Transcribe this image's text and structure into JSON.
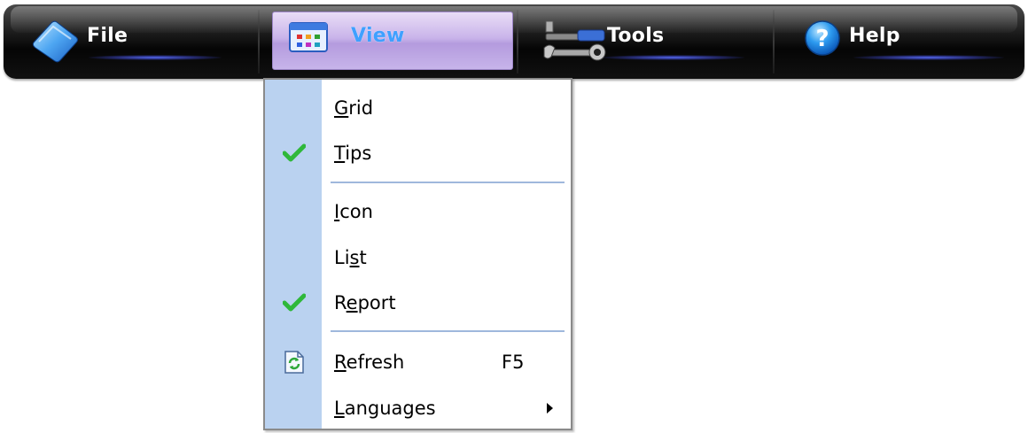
{
  "menubar": {
    "items": [
      {
        "label": "File",
        "icon": "folder-icon"
      },
      {
        "label": "View",
        "icon": "window-icon",
        "active": true
      },
      {
        "label": "Tools",
        "icon": "tools-icon"
      },
      {
        "label": "Help",
        "icon": "help-icon"
      }
    ]
  },
  "dropdown": {
    "items": [
      {
        "label_pre": "",
        "label_key": "G",
        "label_post": "rid",
        "checked": false
      },
      {
        "label_pre": "",
        "label_key": "T",
        "label_post": "ips",
        "checked": true
      },
      {
        "label_pre": "",
        "label_key": "I",
        "label_post": "con",
        "checked": false
      },
      {
        "label_pre": "Li",
        "label_key": "s",
        "label_post": "t",
        "checked": false
      },
      {
        "label_pre": "R",
        "label_key": "e",
        "label_post": "port",
        "checked": true
      },
      {
        "label_pre": "",
        "label_key": "R",
        "label_post": "efresh",
        "shortcut": "F5",
        "icon": "refresh-icon"
      },
      {
        "label_pre": "",
        "label_key": "L",
        "label_post": "anguages",
        "submenu": true,
        "icon": "submenu-arrow-icon"
      }
    ]
  },
  "colors": {
    "menubar_bg": "#0a0a0a",
    "view_highlight": "#c9b4ea",
    "view_label": "#3fa0ff",
    "gutter": "#bad2f0",
    "check": "#2fb83a"
  }
}
